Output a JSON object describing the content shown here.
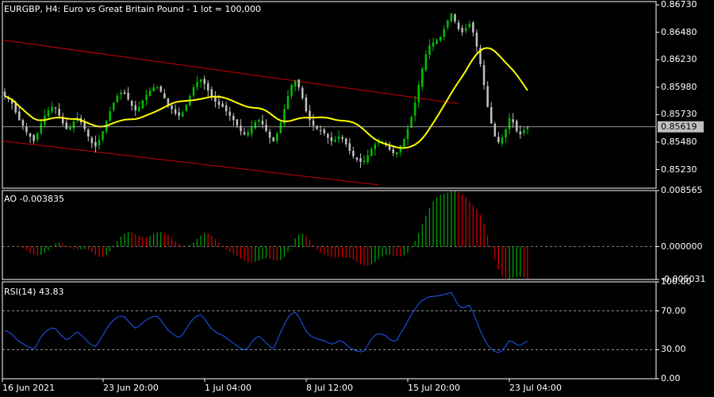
{
  "header": {
    "title": "EURGBP, H4:  Euro vs Great Britain Pound - 1 lot = 100,000"
  },
  "colors": {
    "background": "#000000",
    "frame": "#ffffff",
    "grid": "#c0c0c0",
    "bull": "#00c000",
    "bear": "#c0c0c0",
    "ma": "#ffff00",
    "channel": "#d00000",
    "ao_up": "#00aa00",
    "ao_down": "#dd0000",
    "rsi": "#1e5bff"
  },
  "chart_data": [
    {
      "type": "candlestick",
      "title": "EURGBP, H4:  Euro vs Great Britain Pound - 1 lot = 100,000",
      "ylim": [
        0.8506,
        0.8676
      ],
      "y_ticks": [
        "0.86730",
        "0.86480",
        "0.86230",
        "0.85980",
        "0.85730",
        "0.85480",
        "0.85230"
      ],
      "current_price": "0.85619",
      "x_ticks": [
        "16 Jun 2021",
        "23 Jun 20:00",
        "1 Jul 04:00",
        "8 Jul 12:00",
        "15 Jul 20:00",
        "23 Jul 04:00"
      ],
      "close": [
        0.859,
        0.8587,
        0.8583,
        0.8575,
        0.8568,
        0.8563,
        0.8557,
        0.8553,
        0.8549,
        0.8556,
        0.8565,
        0.8572,
        0.8577,
        0.858,
        0.8579,
        0.8572,
        0.8565,
        0.856,
        0.8562,
        0.8567,
        0.857,
        0.8566,
        0.856,
        0.8553,
        0.8547,
        0.8544,
        0.855,
        0.8558,
        0.8567,
        0.8576,
        0.8584,
        0.859,
        0.8593,
        0.8592,
        0.8587,
        0.8581,
        0.8577,
        0.858,
        0.8586,
        0.8591,
        0.8595,
        0.8598,
        0.8598,
        0.8594,
        0.8588,
        0.8582,
        0.8578,
        0.8574,
        0.8572,
        0.8575,
        0.8582,
        0.859,
        0.8598,
        0.8603,
        0.8605,
        0.8601,
        0.8595,
        0.8589,
        0.8585,
        0.8582,
        0.858,
        0.8576,
        0.8572,
        0.8568,
        0.8563,
        0.8558,
        0.8555,
        0.8557,
        0.8562,
        0.8566,
        0.8568,
        0.8564,
        0.8558,
        0.8552,
        0.8549,
        0.8556,
        0.8566,
        0.8578,
        0.859,
        0.86,
        0.8604,
        0.8598,
        0.8588,
        0.8576,
        0.8568,
        0.8563,
        0.856,
        0.8558,
        0.8556,
        0.8552,
        0.8549,
        0.855,
        0.8553,
        0.8551,
        0.8546,
        0.854,
        0.8535,
        0.8532,
        0.853,
        0.8531,
        0.8536,
        0.8542,
        0.8546,
        0.8548,
        0.8547,
        0.8545,
        0.8541,
        0.8538,
        0.8539,
        0.8545,
        0.8551,
        0.856,
        0.8571,
        0.8584,
        0.86,
        0.8615,
        0.8628,
        0.8636,
        0.8639,
        0.8641,
        0.8644,
        0.8651,
        0.8659,
        0.8665,
        0.8658,
        0.8651,
        0.8648,
        0.8652,
        0.8656,
        0.8648,
        0.8635,
        0.8619,
        0.86,
        0.858,
        0.8565,
        0.8553,
        0.8548,
        0.8552,
        0.856,
        0.857,
        0.8566,
        0.8558,
        0.8555,
        0.8559,
        0.8562
      ],
      "ma_period": 21,
      "channel": {
        "upper": [
          {
            "t": 0,
            "price": 0.8641
          },
          {
            "t": 125,
            "price": 0.8583
          }
        ],
        "lower": [
          {
            "t": 0,
            "price": 0.8549
          },
          {
            "t": 103,
            "price": 0.8509
          }
        ]
      }
    },
    {
      "type": "histogram",
      "label": "AO -0.003835",
      "ylim": [
        -0.005031,
        0.008565
      ],
      "y_ticks": [
        "0.008565",
        "0.000000",
        "-0.005031"
      ]
    },
    {
      "type": "line",
      "label": "RSI(14) 43.83",
      "ylim": [
        0,
        100
      ],
      "y_ticks": [
        "100.00",
        "70.00",
        "30.00",
        "0.00"
      ],
      "levels": [
        70,
        30
      ],
      "period": 14
    }
  ]
}
